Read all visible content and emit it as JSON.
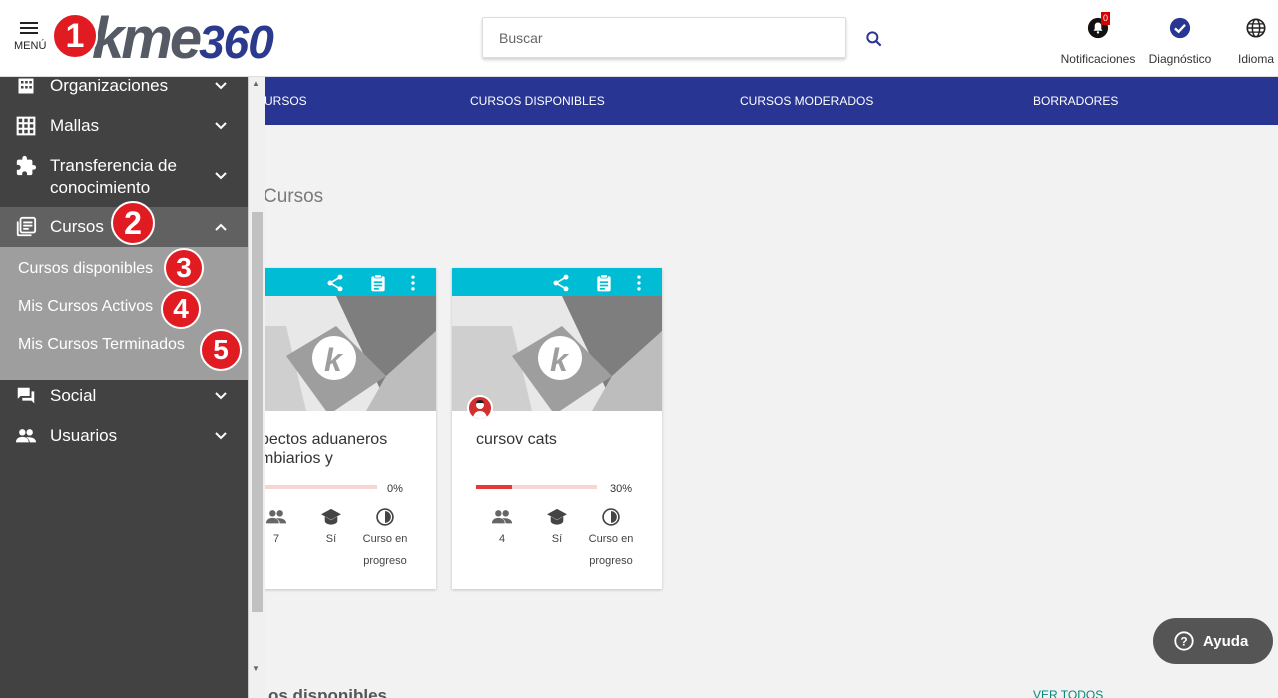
{
  "header": {
    "menu_label": "MENÚ",
    "logo_text": "kme",
    "logo_num": "360",
    "search_placeholder": "Buscar",
    "notifications_label": "Notificaciones",
    "notifications_count": "0",
    "diagnostic_label": "Diagnóstico",
    "language_label": "Idioma"
  },
  "navbar": {
    "tabs": [
      "URSOS",
      "CURSOS DISPONIBLES",
      "CURSOS MODERADOS",
      "BORRADORES"
    ]
  },
  "sidebar": {
    "items": [
      {
        "label": "Organizaciones",
        "icon": "building-icon"
      },
      {
        "label": "Mallas",
        "icon": "grid-icon"
      },
      {
        "label": "Transferencia de conocimiento",
        "icon": "puzzle-icon"
      },
      {
        "label": "Cursos",
        "icon": "library-icon"
      },
      {
        "label": "Social",
        "icon": "forum-icon"
      },
      {
        "label": "Usuarios",
        "icon": "people-icon"
      }
    ],
    "cursos_sub": [
      "Cursos disponibles",
      "Mis Cursos Activos",
      "Mis Cursos Terminados"
    ]
  },
  "annotations": [
    "1",
    "2",
    "3",
    "4",
    "5"
  ],
  "main": {
    "section_title": "Cursos",
    "cards": [
      {
        "title": "pectos aduaneros\nmbiarios y",
        "progress": 0,
        "progress_label": "0%",
        "students": "7",
        "certificate": "Sí",
        "status": "Curso en progreso"
      },
      {
        "title": "cursov cats",
        "progress": 30,
        "progress_label": "30%",
        "students": "4",
        "certificate": "Sí",
        "status": "Curso en progreso"
      }
    ],
    "bottom_title": "os disponibles",
    "ver_todos": "VER TODOS"
  },
  "help": {
    "label": "Ayuda"
  },
  "colors": {
    "navbar": "#283593",
    "card_bar": "#00bcd4",
    "sidebar": "#424242",
    "annotation": "#e11b22"
  }
}
